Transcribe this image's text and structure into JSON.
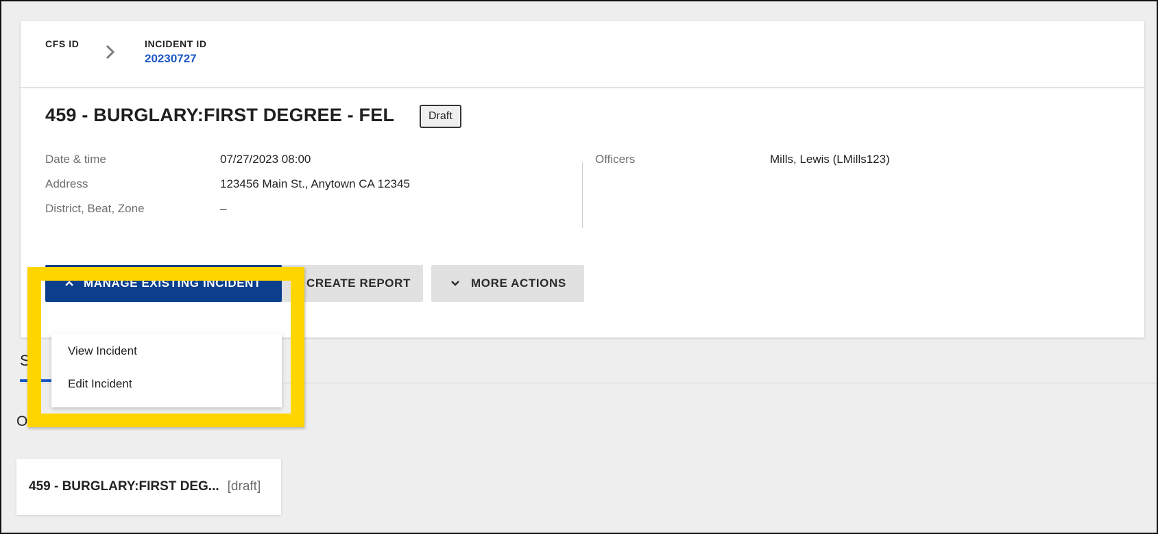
{
  "breadcrumb": {
    "cfs_label": "CFS ID",
    "incident_label": "INCIDENT ID",
    "incident_value": "20230727"
  },
  "incident": {
    "title": "459 - BURGLARY:FIRST DEGREE - FEL",
    "status_badge": "Draft",
    "details": {
      "datetime_label": "Date & time",
      "datetime_value": "07/27/2023 08:00",
      "address_label": "Address",
      "address_value": "123456 Main St., Anytown CA 12345",
      "district_label": "District, Beat, Zone",
      "district_value": "–",
      "officers_label": "Officers",
      "officers_value": "Mills, Lewis (LMills123)"
    }
  },
  "actions": {
    "manage_label": "MANAGE EXISTING INCIDENT",
    "create_label": "CREATE REPORT",
    "more_label": "MORE ACTIONS"
  },
  "dropdown": {
    "items": [
      "View Incident",
      "Edit Incident"
    ]
  },
  "tab": {
    "partial_label": "S"
  },
  "section": {
    "partial_label": "O"
  },
  "summary_card": {
    "title": "459 - BURGLARY:FIRST DEG...",
    "status": "[draft]"
  },
  "colors": {
    "primary_button": "#0b3f8d",
    "link_blue": "#1a57c5",
    "highlight_yellow": "#ffd500",
    "page_background": "#eeeeee"
  }
}
